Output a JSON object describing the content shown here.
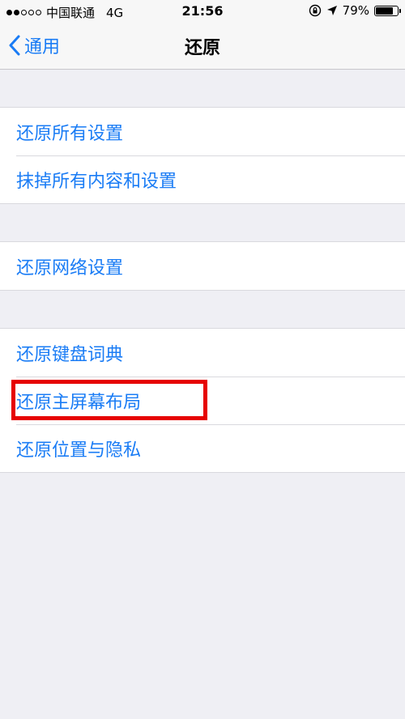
{
  "status_bar": {
    "carrier": "中国联通",
    "network": "4G",
    "time": "21:56",
    "battery_percent": "79%",
    "battery_level": 0.79,
    "icons": [
      "signal-dots-icon",
      "orientation-lock-icon",
      "location-arrow-icon",
      "battery-icon"
    ]
  },
  "nav": {
    "back_label": "通用",
    "title": "还原"
  },
  "groups": [
    {
      "items": [
        "还原所有设置",
        "抹掉所有内容和设置"
      ]
    },
    {
      "items": [
        "还原网络设置"
      ]
    },
    {
      "items": [
        "还原键盘词典",
        "还原主屏幕布局",
        "还原位置与隐私"
      ]
    }
  ],
  "colors": {
    "accent": "#1a7cf5",
    "background": "#efeff4",
    "highlight": "#e60000"
  }
}
